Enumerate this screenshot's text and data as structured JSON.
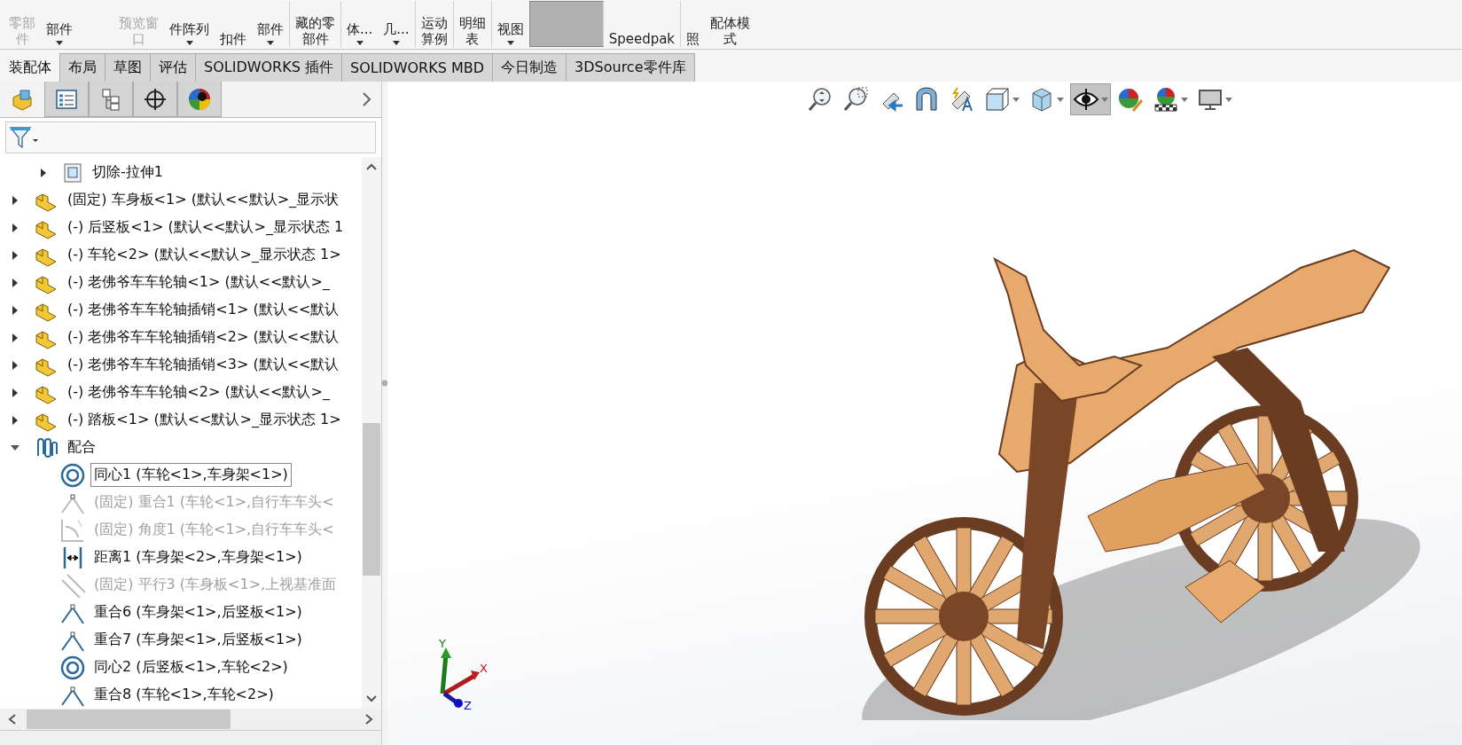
{
  "ribbon": [
    {
      "kind": "button",
      "lines": [
        "零部",
        "件"
      ],
      "disabled": true,
      "dropdown": false,
      "selected": false,
      "separator_after": false
    },
    {
      "kind": "button",
      "lines": [
        "部件"
      ],
      "disabled": false,
      "dropdown": true,
      "selected": false,
      "separator_after": false
    },
    {
      "kind": "gap"
    },
    {
      "kind": "button",
      "lines": [
        "预览窗",
        "口"
      ],
      "disabled": true,
      "dropdown": false,
      "selected": false,
      "separator_after": false
    },
    {
      "kind": "button",
      "lines": [
        "件阵列"
      ],
      "disabled": false,
      "dropdown": true,
      "selected": false,
      "separator_after": false
    },
    {
      "kind": "button",
      "lines": [
        "扣件"
      ],
      "disabled": false,
      "dropdown": false,
      "selected": false,
      "separator_after": false
    },
    {
      "kind": "button",
      "lines": [
        "部件"
      ],
      "disabled": false,
      "dropdown": true,
      "selected": false,
      "separator_after": true
    },
    {
      "kind": "button",
      "lines": [
        "藏的零",
        "部件"
      ],
      "disabled": false,
      "dropdown": false,
      "selected": false,
      "separator_after": true
    },
    {
      "kind": "button",
      "lines": [
        "体..."
      ],
      "disabled": false,
      "dropdown": true,
      "selected": false,
      "separator_after": false
    },
    {
      "kind": "button",
      "lines": [
        "几..."
      ],
      "disabled": false,
      "dropdown": true,
      "selected": false,
      "separator_after": true
    },
    {
      "kind": "button",
      "lines": [
        "运动",
        "算例"
      ],
      "disabled": false,
      "dropdown": false,
      "selected": false,
      "separator_after": true
    },
    {
      "kind": "button",
      "lines": [
        "明细",
        "表"
      ],
      "disabled": false,
      "dropdown": false,
      "selected": false,
      "separator_after": true
    },
    {
      "kind": "button",
      "lines": [
        "视图"
      ],
      "disabled": false,
      "dropdown": true,
      "selected": false,
      "separator_after": false
    },
    {
      "kind": "button",
      "disabled": false,
      "dropdown": false,
      "selected": true,
      "separator_after": true
    },
    {
      "kind": "button",
      "lines": [
        "Speedpak"
      ],
      "disabled": false,
      "dropdown": false,
      "selected": false,
      "separator_after": true
    },
    {
      "kind": "button",
      "lines": [
        "照"
      ],
      "disabled": false,
      "dropdown": false,
      "selected": false,
      "separator_after": false
    },
    {
      "kind": "button",
      "lines": [
        "配体模",
        "式"
      ],
      "disabled": false,
      "dropdown": false,
      "selected": false,
      "separator_after": false
    }
  ],
  "tabs": [
    {
      "label": "装配体",
      "selected": true
    },
    {
      "label": "布局",
      "selected": false
    },
    {
      "label": "草图",
      "selected": false
    },
    {
      "label": "评估",
      "selected": false
    },
    {
      "label": "SOLIDWORKS 插件",
      "selected": false
    },
    {
      "label": "SOLIDWORKS MBD",
      "selected": false
    },
    {
      "label": "今日制造",
      "selected": false
    },
    {
      "label": "3DSource零件库",
      "selected": false
    }
  ],
  "view_toolbar": [
    {
      "kind": "zoom-fit",
      "selected": false,
      "dropdown": false
    },
    {
      "kind": "zoom-area",
      "selected": false,
      "dropdown": false
    },
    {
      "kind": "previous-view",
      "selected": false,
      "dropdown": false
    },
    {
      "kind": "section",
      "selected": false,
      "dropdown": false
    },
    {
      "kind": "annotation",
      "selected": false,
      "dropdown": false
    },
    {
      "kind": "orientation",
      "selected": false,
      "dropdown": true
    },
    {
      "kind": "display-style",
      "selected": false,
      "dropdown": true
    },
    {
      "kind": "hide-show",
      "selected": true,
      "dropdown": true
    },
    {
      "kind": "appearance",
      "selected": false,
      "dropdown": false
    },
    {
      "kind": "scene",
      "selected": false,
      "dropdown": true
    },
    {
      "kind": "monitor",
      "selected": false,
      "dropdown": true
    }
  ],
  "panel_tabs": [
    {
      "kind": "feature-tree",
      "selected": true
    },
    {
      "kind": "property",
      "selected": false
    },
    {
      "kind": "configuration",
      "selected": false
    },
    {
      "kind": "target",
      "selected": false
    },
    {
      "kind": "display",
      "selected": false
    }
  ],
  "tree": [
    {
      "kind": "feature",
      "label": "切除-拉伸1",
      "expanded": false,
      "selected": false
    },
    {
      "kind": "part",
      "label": "(固定) 车身板<1> (默认<<默认>_显示状",
      "expanded": false,
      "selected": false
    },
    {
      "kind": "part",
      "label": "(-) 后竖板<1> (默认<<默认>_显示状态 1",
      "expanded": false,
      "selected": false
    },
    {
      "kind": "part",
      "label": "(-) 车轮<2> (默认<<默认>_显示状态 1>",
      "expanded": false,
      "selected": false
    },
    {
      "kind": "part",
      "label": "(-) 老佛爷车车轮轴<1> (默认<<默认>_",
      "expanded": false,
      "selected": false
    },
    {
      "kind": "part",
      "label": "(-) 老佛爷车车轮轴插销<1> (默认<<默认",
      "expanded": false,
      "selected": false
    },
    {
      "kind": "part",
      "label": "(-) 老佛爷车车轮轴插销<2> (默认<<默认",
      "expanded": false,
      "selected": false
    },
    {
      "kind": "part",
      "label": "(-) 老佛爷车车轮轴插销<3> (默认<<默认",
      "expanded": false,
      "selected": false
    },
    {
      "kind": "part",
      "label": "(-) 老佛爷车车轮轴<2> (默认<<默认>_",
      "expanded": false,
      "selected": false
    },
    {
      "kind": "part",
      "label": "(-) 踏板<1> (默认<<默认>_显示状态 1>",
      "expanded": false,
      "selected": false
    },
    {
      "kind": "mates",
      "label": "配合",
      "expanded": true,
      "selected": false,
      "children": [
        {
          "kind": "concentric",
          "label": "同心1 (车轮<1>,车身架<1>)",
          "selected": true,
          "suppressed": false
        },
        {
          "kind": "coincident",
          "label": "(固定) 重合1 (车轮<1>,自行车车头<",
          "selected": false,
          "suppressed": true
        },
        {
          "kind": "angle",
          "label": "(固定) 角度1 (车轮<1>,自行车车头<",
          "selected": false,
          "suppressed": true
        },
        {
          "kind": "distance",
          "label": "距离1 (车身架<2>,车身架<1>)",
          "selected": false,
          "suppressed": false
        },
        {
          "kind": "parallel",
          "label": "(固定) 平行3 (车身板<1>,上视基准面",
          "selected": false,
          "suppressed": true
        },
        {
          "kind": "coincident",
          "label": "重合6 (车身架<1>,后竖板<1>)",
          "selected": false,
          "suppressed": false
        },
        {
          "kind": "coincident",
          "label": "重合7 (车身架<1>,后竖板<1>)",
          "selected": false,
          "suppressed": false
        },
        {
          "kind": "concentric",
          "label": "同心2 (后竖板<1>,车轮<2>)",
          "selected": false,
          "suppressed": false
        },
        {
          "kind": "coincident",
          "label": "重合8 (车轮<1>,车轮<2>)",
          "selected": false,
          "suppressed": false
        }
      ]
    }
  ],
  "triad": {
    "x": "X",
    "y": "Y",
    "z": "Z"
  }
}
